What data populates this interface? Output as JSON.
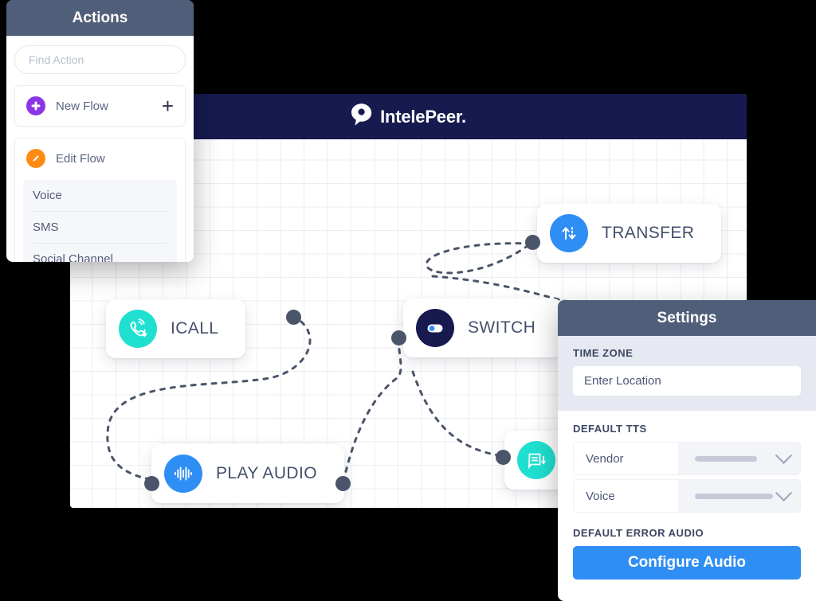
{
  "canvas": {
    "brand": {
      "logo_icon": "speech-bubble-p-icon",
      "name": "IntelePeer",
      "trademark_dot": "."
    },
    "nodes": [
      {
        "id": "transfer",
        "label": "TRANSFER",
        "icon": "transfer-arrows-icon",
        "icon_bg": "#2f8ef4"
      },
      {
        "id": "icall",
        "label": "ICALL",
        "icon": "phone-ringing-icon",
        "icon_bg": "#1fe0d0"
      },
      {
        "id": "switch",
        "label": "SWITCH",
        "icon": "toggle-switch-icon",
        "icon_bg": "#161a4e"
      },
      {
        "id": "play_audio",
        "label": "PLAY AUDIO",
        "icon": "audio-waveform-icon",
        "icon_bg": "#2f8ef4"
      },
      {
        "id": "message",
        "label": "",
        "icon": "message-document-icon",
        "icon_bg": "#1fe0d0"
      }
    ]
  },
  "actions_panel": {
    "title": "Actions",
    "search": {
      "placeholder": "Find Action",
      "value": ""
    },
    "new_flow": {
      "label": "New Flow",
      "icon": "plus-circle-icon",
      "add_icon": "plus-icon"
    },
    "edit_flow": {
      "label": "Edit Flow",
      "icon": "pencil-circle-icon"
    },
    "channels": [
      {
        "label": "Voice"
      },
      {
        "label": "SMS"
      },
      {
        "label": "Social Channel"
      }
    ]
  },
  "settings_panel": {
    "title": "Settings",
    "time_zone": {
      "section_title": "TIME ZONE",
      "input_placeholder": "Enter Location",
      "input_value": "Enter Location"
    },
    "default_tts": {
      "section_title": "DEFAULT TTS",
      "rows": [
        {
          "label": "Vendor",
          "value": "",
          "chevron": "chevron-down-icon"
        },
        {
          "label": "Voice",
          "value": "",
          "chevron": "chevron-down-icon"
        }
      ]
    },
    "default_error_audio": {
      "section_title": "DEFAULT ERROR AUDIO",
      "button_label": "Configure Audio"
    }
  },
  "colors": {
    "header_navy": "#161a4e",
    "panel_header_slate": "#505f79",
    "accent_blue": "#2f8ef4",
    "accent_teal": "#1fe0d0",
    "accent_purple": "#8b35e8",
    "accent_orange": "#ff8a14",
    "edge_slate": "#4b5569"
  }
}
